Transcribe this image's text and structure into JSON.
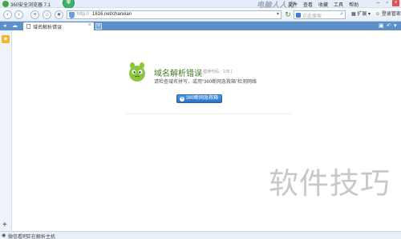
{
  "window": {
    "title": "360安全浏览器 7.1",
    "top_watermark": "电脑人人有",
    "menu": [
      "文件",
      "查看",
      "收藏",
      "工具",
      "帮助"
    ]
  },
  "toolbar": {
    "protocol": "http://",
    "url": "1616.net/chanxian",
    "search_placeholder": "点此搜索",
    "extensions_label": "扩展",
    "login_label": "登录管家"
  },
  "tabs": [
    {
      "label": "域名解析错误"
    }
  ],
  "error_page": {
    "title": "域名解析错误",
    "code": "( 错误代码：105 )",
    "description": "请检查域名拼写，或用“360断网急救箱”检测网络",
    "button_label": "360断网急救箱"
  },
  "watermark": "软件技巧",
  "statusbar": {
    "left": "微信看吧",
    "right": "正在解析主机"
  },
  "colors": {
    "accent": "#5d8fc8",
    "button": "#2a72c6",
    "title_green": "#3d7a2a",
    "mascot": "#8cc63f"
  }
}
